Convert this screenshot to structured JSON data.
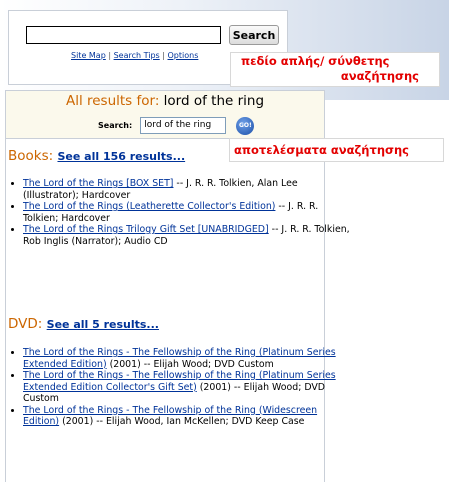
{
  "search_bar": {
    "button_label": "Search",
    "input_value": "",
    "links": {
      "site_map": "Site Map",
      "sep1": " | ",
      "search_tips": "Search Tips",
      "sep2": " | ",
      "options": "Options"
    }
  },
  "annotations": {
    "search_field_line1": "πεδίο απλής/ σύνθετης",
    "search_field_line2": "αναζήτησης",
    "results": "αποτελέσματα αναζήτησης"
  },
  "results": {
    "header_prefix": "All results for: ",
    "query": "lord of the ring",
    "search_label": "Search:",
    "search_value": "lord of the ring",
    "go_label": "GO!"
  },
  "books": {
    "title": "Books: ",
    "see_all": "See all 156 results...",
    "items": [
      {
        "link": "The Lord of the Rings [BOX SET]",
        "details": " -- J. R. R. Tolkien, Alan Lee (Illustrator); Hardcover"
      },
      {
        "link": "The Lord of the Rings (Leatherette Collector's Edition)",
        "details": " -- J. R. R. Tolkien; Hardcover"
      },
      {
        "link": "The Lord of the Rings Trilogy Gift Set [UNABRIDGED]",
        "details": " -- J. R. R. Tolkien, Rob Inglis (Narrator); Audio CD"
      }
    ]
  },
  "dvd": {
    "title": "DVD: ",
    "see_all": "See all 5 results...",
    "items": [
      {
        "link": "The Lord of the Rings - The Fellowship of the Ring (Platinum Series Extended Edition)",
        "details": " (2001) -- Elijah Wood; DVD Custom"
      },
      {
        "link": "The Lord of the Rings - The Fellowship of the Ring (Platinum Series Extended Edition Collector's Gift Set)",
        "details": " (2001) -- Elijah Wood; DVD Custom"
      },
      {
        "link": "The Lord of the Rings - The Fellowship of the Ring (Widescreen Edition)",
        "details": " (2001) -- Elijah Wood, Ian McKellen; DVD Keep Case"
      }
    ]
  }
}
